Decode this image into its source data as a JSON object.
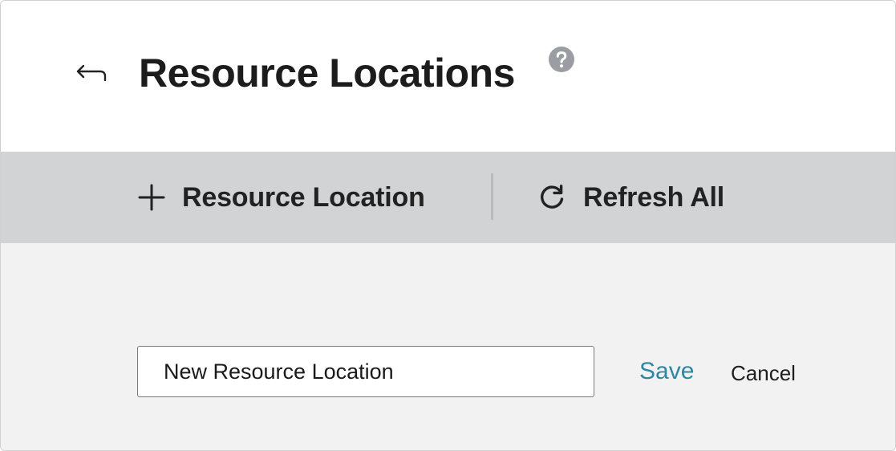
{
  "header": {
    "back_icon": "back-arrow-icon",
    "title": "Resource Locations",
    "help_icon": "help-icon"
  },
  "toolbar": {
    "add_icon": "plus-icon",
    "add_label": "Resource Location",
    "refresh_icon": "refresh-icon",
    "refresh_label": "Refresh All"
  },
  "form": {
    "name_value": "New Resource Location",
    "save_label": "Save",
    "cancel_label": "Cancel"
  },
  "colors": {
    "toolbar_bg": "#d1d3d5",
    "content_bg": "#f2f2f2",
    "accent_link": "#2e86a5",
    "help_icon": "#9a9ea3"
  }
}
